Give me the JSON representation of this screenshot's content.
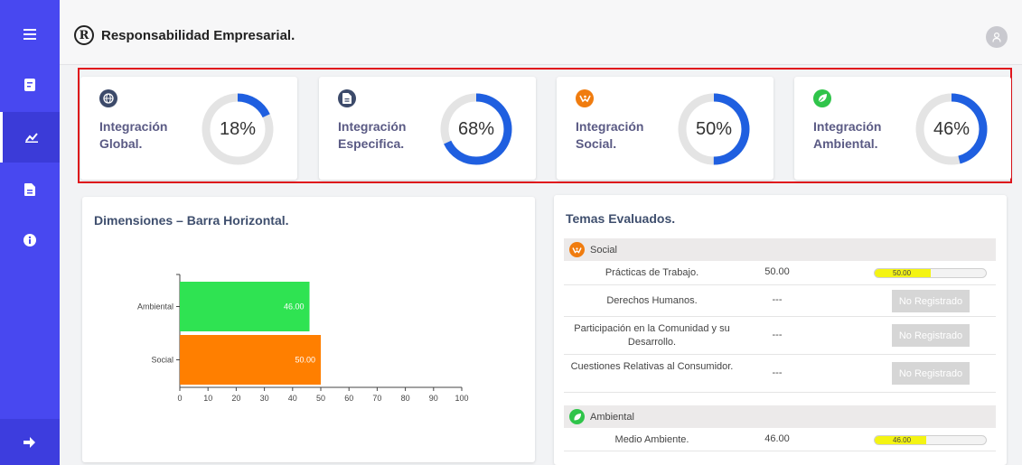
{
  "header": {
    "title": "Responsabilidad Empresarial.",
    "logo_letter": "R"
  },
  "sidebar": {
    "items": [
      {
        "icon": "menu-icon",
        "active": false
      },
      {
        "icon": "report-icon",
        "active": false
      },
      {
        "icon": "chart-line-icon",
        "active": true
      },
      {
        "icon": "document-icon",
        "active": false
      },
      {
        "icon": "info-icon",
        "active": false
      }
    ],
    "logout_icon": "logout-icon"
  },
  "kpis": [
    {
      "label": "Integración Global.",
      "percent_text": "18%",
      "value": 18,
      "icon": "globe-icon",
      "icon_color": "#3c4a6a"
    },
    {
      "label": "Integración Especifica.",
      "percent_text": "68%",
      "value": 68,
      "icon": "document-icon",
      "icon_color": "#3c4a6a"
    },
    {
      "label": "Integración Social.",
      "percent_text": "50%",
      "value": 50,
      "icon": "hands-icon",
      "icon_color": "#f07c0f"
    },
    {
      "label": "Integración Ambiental.",
      "percent_text": "46%",
      "value": 46,
      "icon": "leaf-icon",
      "icon_color": "#2fc44a"
    }
  ],
  "chart_panel": {
    "title": "Dimensiones – Barra Horizontal."
  },
  "chart_data": {
    "type": "bar",
    "orientation": "horizontal",
    "categories": [
      "Ambiental",
      "Social"
    ],
    "values": [
      46.0,
      50.0
    ],
    "data_labels": [
      "46.00",
      "50.00"
    ],
    "colors": [
      "#2fe352",
      "#ff7f00"
    ],
    "xlim": [
      0,
      100
    ],
    "xticks": [
      "0",
      "10",
      "20",
      "30",
      "40",
      "50",
      "60",
      "70",
      "80",
      "90",
      "100"
    ],
    "title": "",
    "xlabel": "",
    "ylabel": "",
    "grid": false
  },
  "table_panel": {
    "title": "Temas Evaluados.",
    "groups": [
      {
        "name": "Social",
        "icon": "hands-icon",
        "icon_color": "#f07c0f",
        "rows": [
          {
            "name": "Prácticas de Trabajo.",
            "value": "50.00",
            "bar_value": 50,
            "bar_label": "50.00"
          },
          {
            "name": "Derechos Humanos.",
            "value": "---",
            "status": "No Registrado"
          },
          {
            "name": "Participación en la Comunidad y su Desarrollo.",
            "value": "---",
            "status": "No Registrado"
          },
          {
            "name": "Cuestiones Relativas al Consumidor.",
            "value": "---",
            "status": "No Registrado"
          }
        ]
      },
      {
        "name": "Ambiental",
        "icon": "leaf-icon",
        "icon_color": "#2fc44a",
        "rows": [
          {
            "name": "Medio Ambiente.",
            "value": "46.00",
            "bar_value": 46,
            "bar_label": "46.00"
          }
        ]
      }
    ]
  },
  "colors": {
    "sidebar": "#4848f0",
    "donut_fill": "#1f5fe0",
    "donut_track": "#e4e4e4",
    "highlight_frame": "#e0141c"
  }
}
